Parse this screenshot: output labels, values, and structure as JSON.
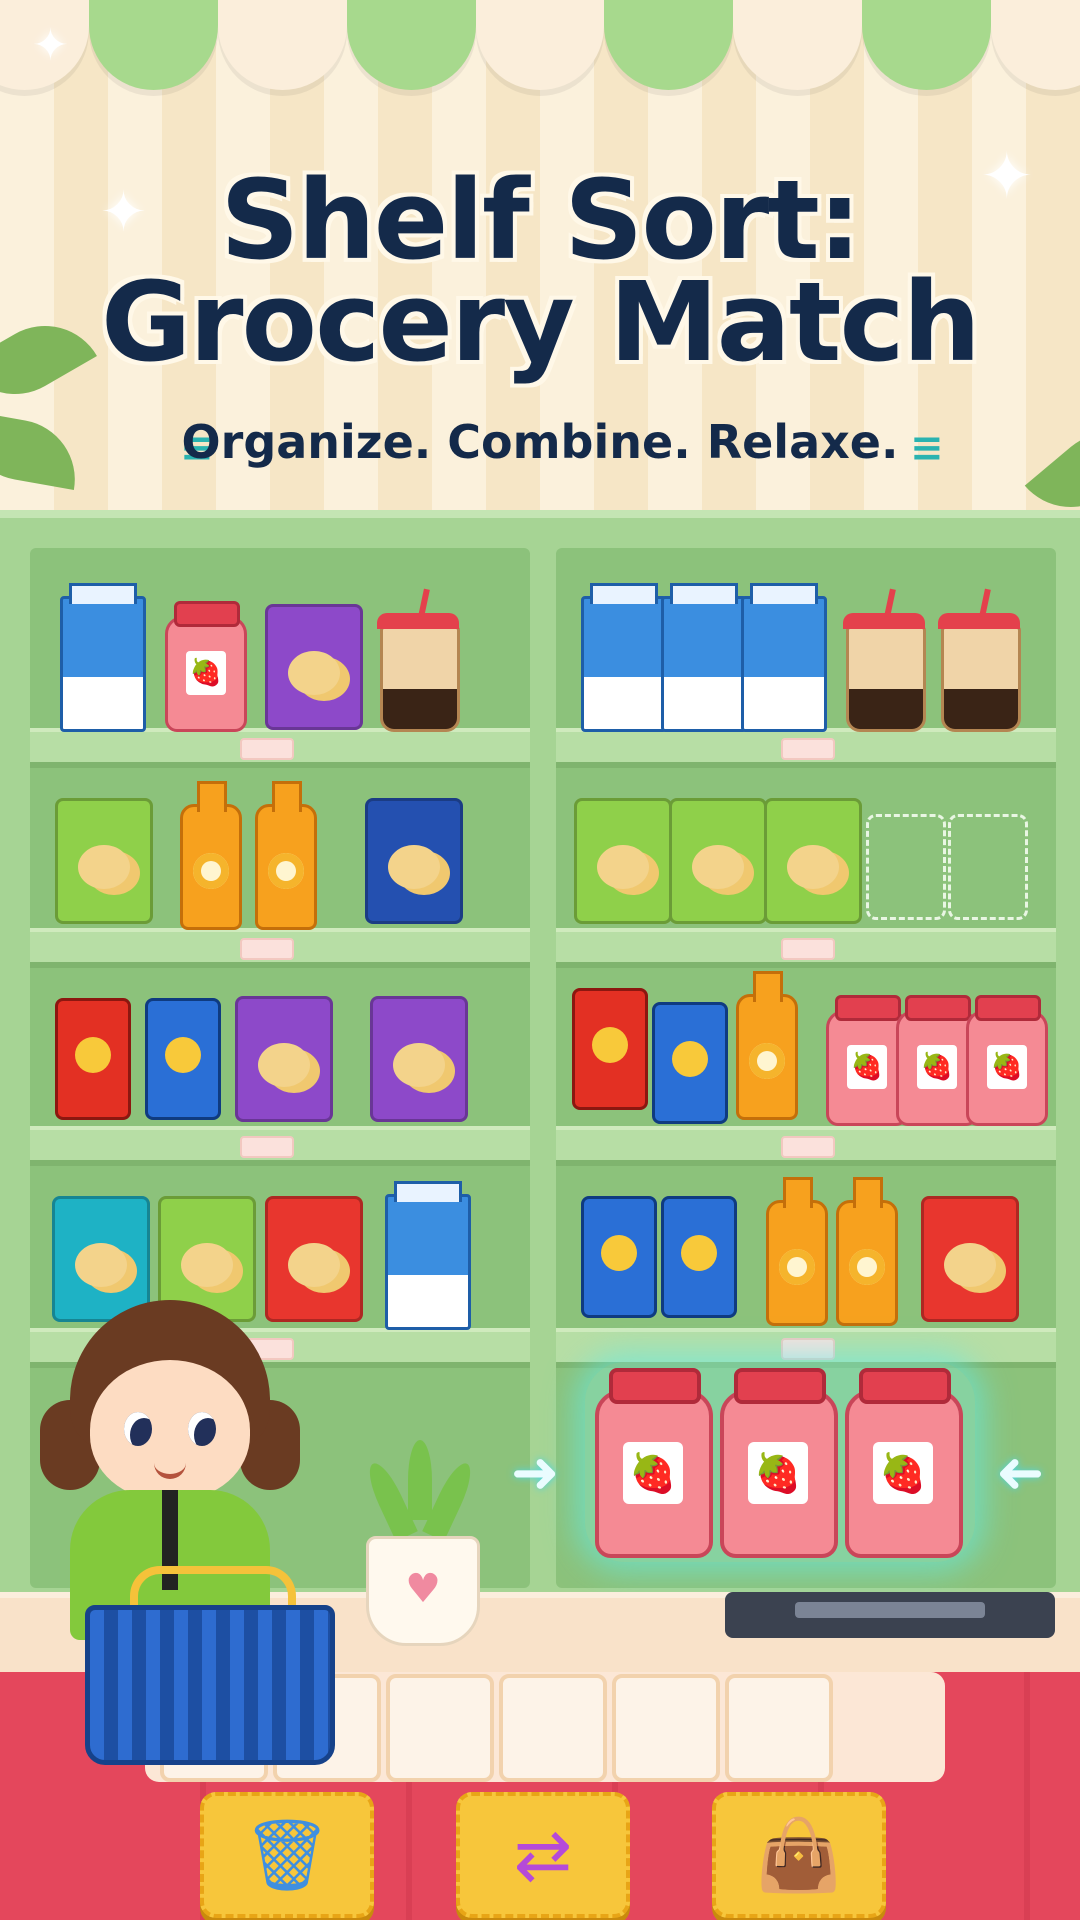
{
  "header": {
    "title_line1": "Shelf Sort:",
    "title_line2": "Grocery Match",
    "subtitle": "Organize. Combine. Relaxe."
  },
  "colors": {
    "title": "#142a4a",
    "shelf": "#8cc27b",
    "accent_teal": "#2ab3b0",
    "base": "#e4475c",
    "button": "#f7c63b"
  },
  "shelves": {
    "left": [
      [
        "milk-carton",
        "strawberry-jam-jar",
        "purple-chip-bag",
        "bubble-tea"
      ],
      [
        "green-chip-bag",
        "orange-juice-bottle",
        "orange-juice-bottle",
        "blue-chip-bag"
      ],
      [
        "red-chip-can",
        "blue-soda-can",
        "purple-chip-bag",
        "purple-chip-bag"
      ],
      [
        "teal-chip-bag",
        "green-chip-bag",
        "red-chip-bag",
        "milk-carton"
      ]
    ],
    "right": [
      [
        "milk-carton",
        "milk-carton",
        "milk-carton",
        "bubble-tea",
        "bubble-tea"
      ],
      [
        "green-chip-bag",
        "green-chip-bag",
        "green-chip-bag",
        "empty-slot",
        "empty-slot"
      ],
      [
        "red-chip-can",
        "blue-soda-can",
        "orange-juice-bottle",
        "strawberry-jam-jar",
        "strawberry-jam-jar",
        "strawberry-jam-jar"
      ],
      [
        "blue-soda-can",
        "blue-soda-can",
        "orange-juice-bottle",
        "orange-juice-bottle",
        "red-chip-bag"
      ]
    ]
  },
  "matched_group": [
    "strawberry-jam-jar",
    "strawberry-jam-jar",
    "strawberry-jam-jar"
  ],
  "tray_slots_empty": 6,
  "toolbar": {
    "trash_icon": "trash-can-icon",
    "shuffle_icon": "shuffle-arrows-icon",
    "bag_icon": "paper-bag-icon"
  }
}
